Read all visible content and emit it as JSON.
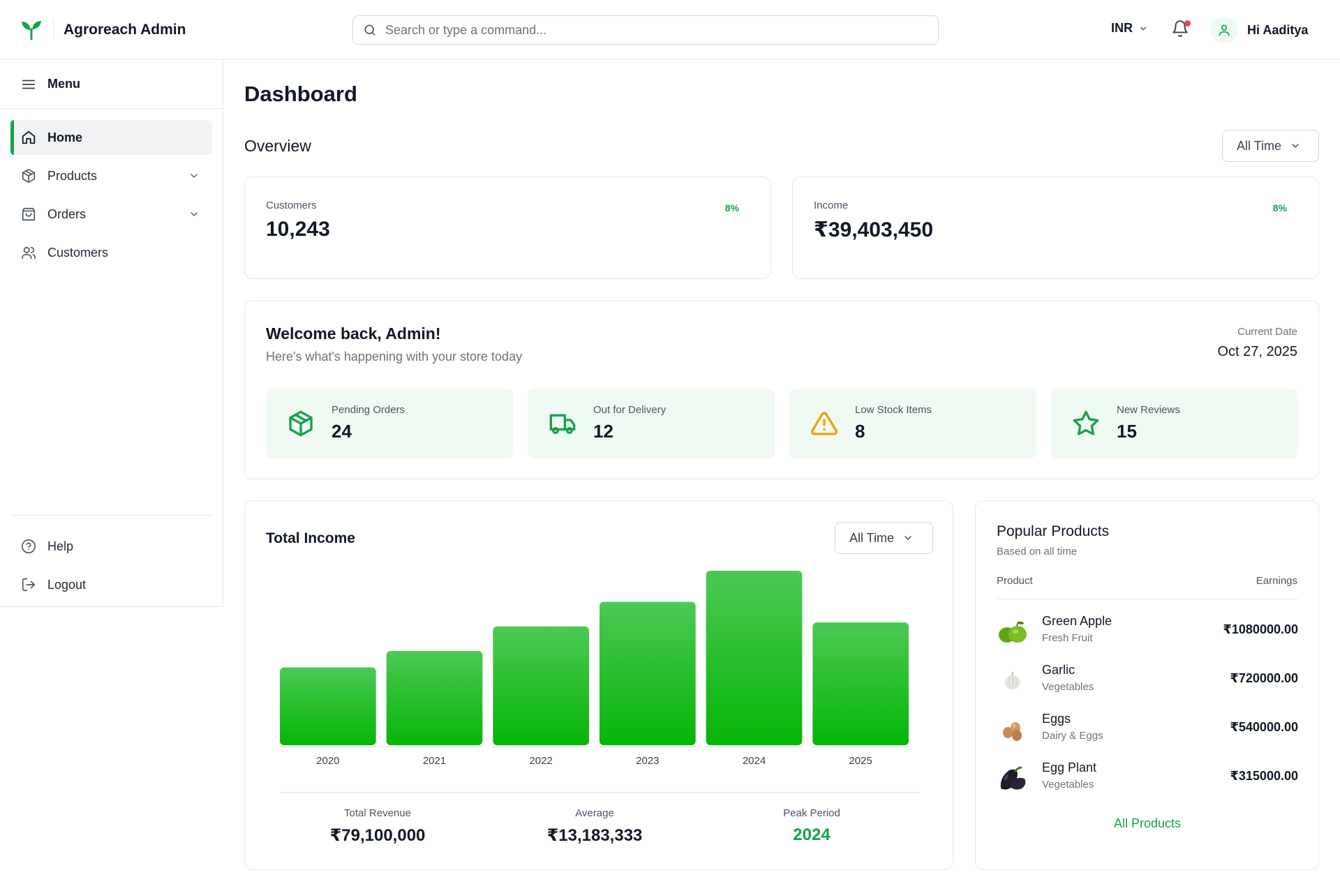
{
  "header": {
    "brand_name": "Agroreach Admin",
    "search_placeholder": "Search or type a command...",
    "currency": "INR",
    "greeting": "Hi Aaditya"
  },
  "sidebar": {
    "menu_label": "Menu",
    "items": [
      {
        "label": "Home",
        "icon": "home-icon",
        "active": true
      },
      {
        "label": "Products",
        "icon": "package-icon",
        "expandable": true
      },
      {
        "label": "Orders",
        "icon": "shopping-bag-icon",
        "expandable": true
      },
      {
        "label": "Customers",
        "icon": "users-icon"
      }
    ],
    "footer_items": [
      {
        "label": "Help",
        "icon": "help-circle-icon"
      },
      {
        "label": "Logout",
        "icon": "logout-icon"
      }
    ]
  },
  "main": {
    "title": "Dashboard",
    "overview_title": "Overview",
    "overview_range": "All Time",
    "stats": [
      {
        "label": "Customers",
        "value": "10,243",
        "change": "8%"
      },
      {
        "label": "Income",
        "value": "₹39,403,450",
        "change": "8%"
      }
    ],
    "welcome": {
      "title": "Welcome back, Admin!",
      "subtitle": "Here's what's happening with your store today",
      "date_label": "Current Date",
      "date_value": "Oct 27, 2025",
      "cards": [
        {
          "label": "Pending Orders",
          "value": "24",
          "icon": "package-icon"
        },
        {
          "label": "Out for Delivery",
          "value": "12",
          "icon": "truck-icon"
        },
        {
          "label": "Low Stock Items",
          "value": "8",
          "icon": "alert-triangle-icon"
        },
        {
          "label": "New Reviews",
          "value": "15",
          "icon": "star-icon"
        }
      ]
    },
    "income": {
      "title": "Total Income",
      "range": "All Time",
      "summary": [
        {
          "label": "Total Revenue",
          "value": "₹79,100,000"
        },
        {
          "label": "Average",
          "value": "₹13,183,333"
        },
        {
          "label": "Peak Period",
          "value": "2024"
        }
      ]
    },
    "popular": {
      "title": "Popular Products",
      "subtitle": "Based on all time",
      "col_product": "Product",
      "col_earnings": "Earnings",
      "rows": [
        {
          "name": "Green Apple",
          "category": "Fresh Fruit",
          "earnings": "₹1080000.00",
          "image": "green-apple-image"
        },
        {
          "name": "Garlic",
          "category": "Vegetables",
          "earnings": "₹720000.00",
          "image": "garlic-image"
        },
        {
          "name": "Eggs",
          "category": "Dairy & Eggs",
          "earnings": "₹540000.00",
          "image": "eggs-image"
        },
        {
          "name": "Egg Plant",
          "category": "Vegetables",
          "earnings": "₹315000.00",
          "image": "eggplant-image"
        }
      ],
      "all_link": "All Products"
    }
  },
  "colors": {
    "accent": "#16a34a",
    "bar_top": "#4cc955",
    "bar_bottom": "#06b506",
    "alert": "#f59e0b",
    "notification_dot": "#ef4444"
  },
  "chart_data": {
    "type": "bar",
    "title": "Total Income",
    "categories": [
      "2020",
      "2021",
      "2022",
      "2023",
      "2024",
      "2025"
    ],
    "values": [
      9500000,
      11500000,
      14500000,
      17500000,
      21300000,
      15000000
    ],
    "ylim": [
      0,
      21300000
    ],
    "grid": false,
    "legend": "none"
  }
}
